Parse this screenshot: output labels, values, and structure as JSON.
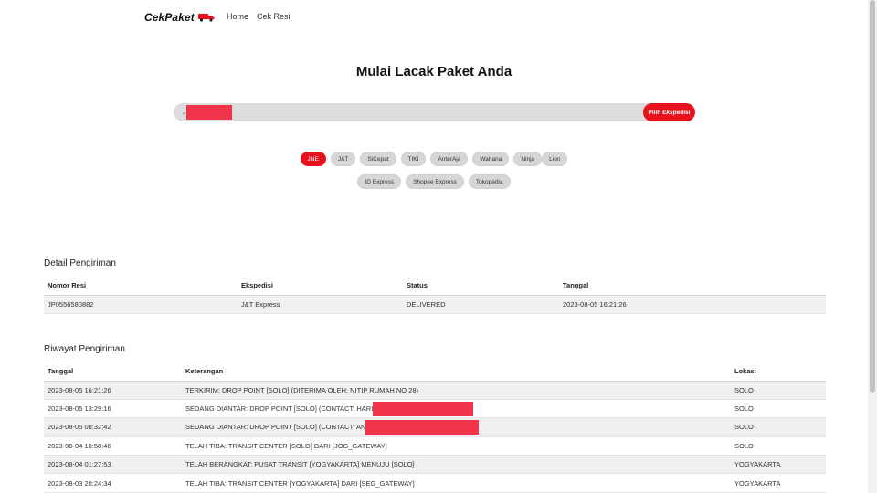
{
  "brand": {
    "name": "CekPaket",
    "icon": "truck-icon",
    "accent": "#e8121f"
  },
  "nav": {
    "items": [
      "Home",
      "Cek Resi"
    ]
  },
  "hero": {
    "title": "Mulai Lacak Paket Anda",
    "search_value": "JP",
    "button_label": "Pilih Ekspedisi"
  },
  "couriers": {
    "row1": [
      "JNE",
      "J&T",
      "SiCepat",
      "TIKI",
      "AnterAja",
      "Wahana",
      "Ninja",
      "Lion"
    ],
    "row2": [
      "ID Express",
      "Shopee Express",
      "Tokopedia"
    ],
    "selected": "JNE"
  },
  "detail": {
    "title": "Detail Pengiriman",
    "headers": [
      "Nomor Resi",
      "Ekspedisi",
      "Status",
      "Tanggal"
    ],
    "row": [
      "JP0556580882",
      "J&T Express",
      "DELIVERED",
      "2023-08-05 16:21:26"
    ]
  },
  "riwayat": {
    "title": "Riwayat Pengiriman",
    "headers": [
      "Tanggal",
      "Keterangan",
      "Lokasi"
    ],
    "rows": [
      [
        "2023-08-05 16:21:26",
        "TERKIRIM: DROP POINT [SOLO] (DITERIMA OLEH: NITIP RUMAH NO 28)",
        "SOLO"
      ],
      [
        "2023-08-05 13:29:16",
        "SEDANG DIANTAR: DROP POINT [SOLO] (CONTACT: HARI",
        "SOLO"
      ],
      [
        "2023-08-05 08:32:42",
        "SEDANG DIANTAR: DROP POINT [SOLO] (CONTACT: AN",
        "SOLO"
      ],
      [
        "2023-08-04 10:58:46",
        "TELAH TIBA: TRANSIT CENTER [SOLO] DARI [JOG_GATEWAY]",
        "SOLO"
      ],
      [
        "2023-08-04 01:27:53",
        "TELAH BERANGKAT: PUSAT TRANSIT [YOGYAKARTA] MENUJU [SOLO]",
        "YOGYAKARTA"
      ],
      [
        "2023-08-03 20:24:34",
        "TELAH TIBA: TRANSIT CENTER [YOGYAKARTA] DARI [SEG_GATEWAY]",
        "YOGYAKARTA"
      ]
    ]
  }
}
